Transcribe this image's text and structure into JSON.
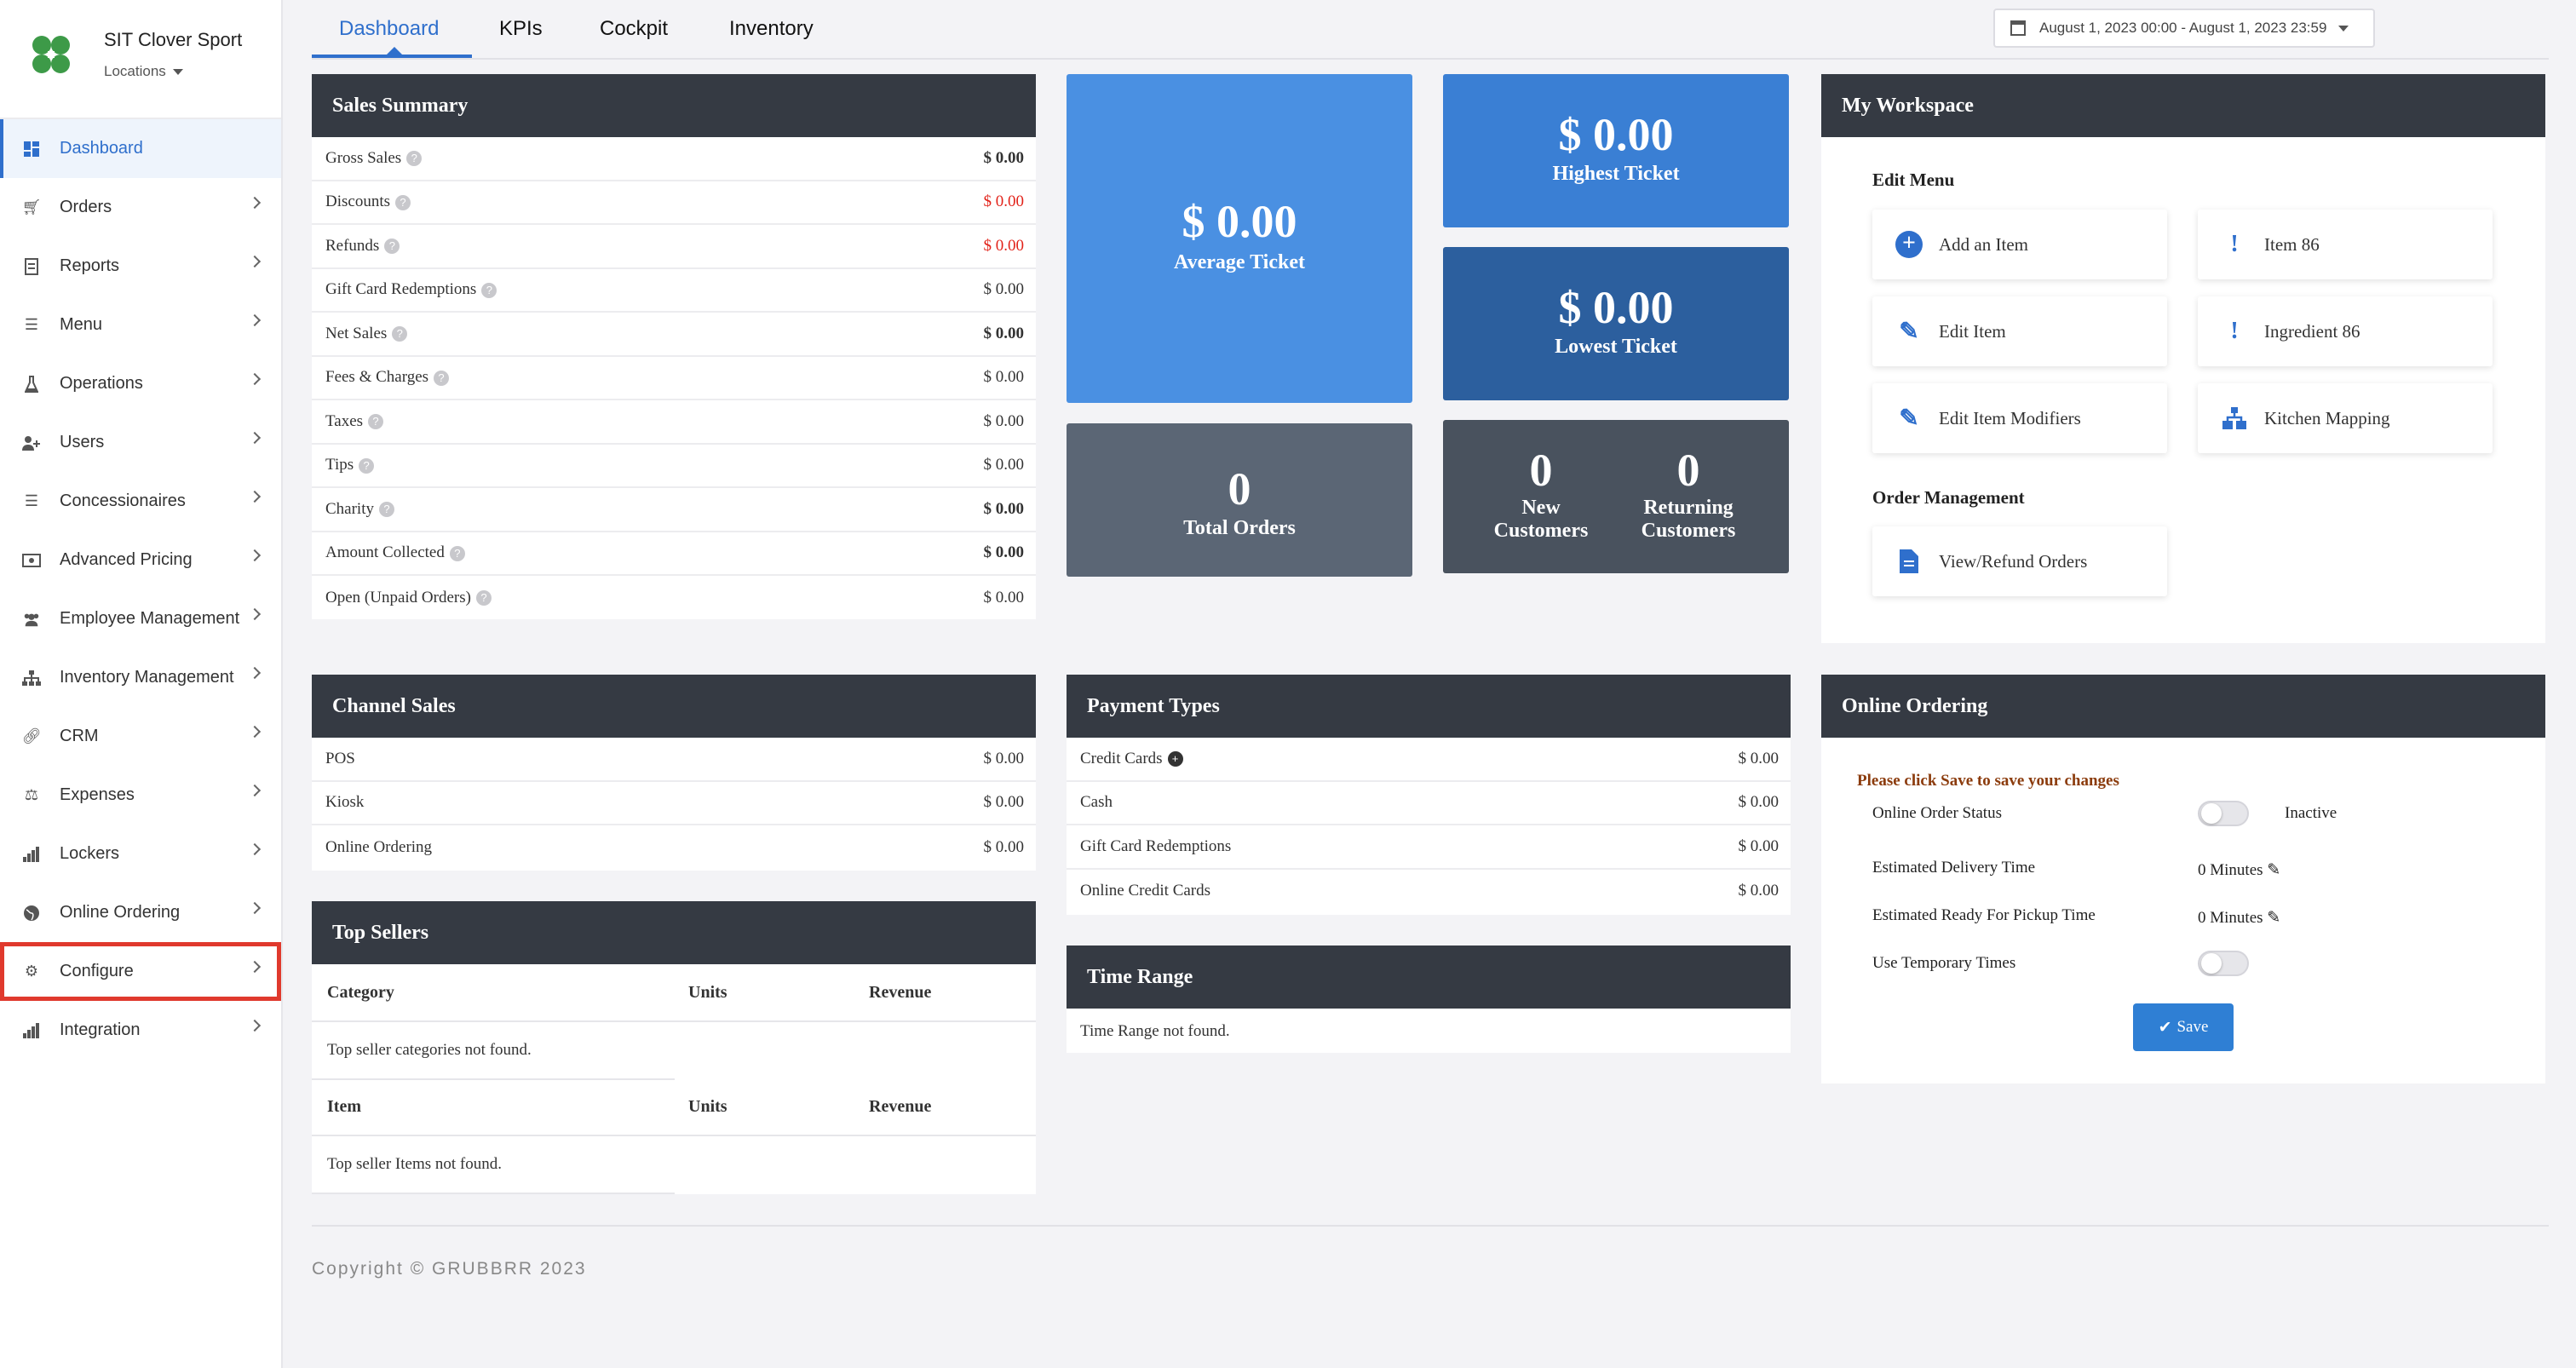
{
  "brand": {
    "name": "SIT Clover Sport",
    "locations_label": "Locations"
  },
  "sidebar": {
    "items": [
      {
        "label": "Dashboard",
        "icon": "dashboard-icon",
        "active": true
      },
      {
        "label": "Orders",
        "icon": "cart-icon"
      },
      {
        "label": "Reports",
        "icon": "report-icon"
      },
      {
        "label": "Menu",
        "icon": "menu-icon"
      },
      {
        "label": "Operations",
        "icon": "flask-icon"
      },
      {
        "label": "Users",
        "icon": "user-plus-icon"
      },
      {
        "label": "Concessionaires",
        "icon": "list-icon"
      },
      {
        "label": "Advanced Pricing",
        "icon": "money-icon"
      },
      {
        "label": "Employee Management",
        "icon": "users-icon"
      },
      {
        "label": "Inventory Management",
        "icon": "sitemap-icon"
      },
      {
        "label": "CRM",
        "icon": "link-icon"
      },
      {
        "label": "Expenses",
        "icon": "scale-icon"
      },
      {
        "label": "Lockers",
        "icon": "signal-icon"
      },
      {
        "label": "Online Ordering",
        "icon": "globe-icon"
      },
      {
        "label": "Configure",
        "icon": "gear-icon",
        "highlighted": true
      },
      {
        "label": "Integration",
        "icon": "signal-icon"
      }
    ]
  },
  "tabs": [
    "Dashboard",
    "KPIs",
    "Cockpit",
    "Inventory"
  ],
  "date_range": "August 1, 2023 00:00 - August 1, 2023 23:59",
  "sales_summary": {
    "title": "Sales Summary",
    "rows": [
      {
        "label": "Gross Sales",
        "value": "$ 0.00",
        "style": "bold"
      },
      {
        "label": "Discounts",
        "value": "$ 0.00",
        "style": "red"
      },
      {
        "label": "Refunds",
        "value": "$ 0.00",
        "style": "red"
      },
      {
        "label": "Gift Card Redemptions",
        "value": "$ 0.00",
        "style": ""
      },
      {
        "label": "Net Sales",
        "value": "$ 0.00",
        "style": "bold"
      },
      {
        "label": "Fees & Charges",
        "value": "$ 0.00",
        "style": ""
      },
      {
        "label": "Taxes",
        "value": "$ 0.00",
        "style": ""
      },
      {
        "label": "Tips",
        "value": "$ 0.00",
        "style": ""
      },
      {
        "label": "Charity",
        "value": "$ 0.00",
        "style": "bold"
      },
      {
        "label": "Amount Collected",
        "value": "$ 0.00",
        "style": "bold"
      },
      {
        "label": "Open (Unpaid Orders)",
        "value": "$ 0.00",
        "style": ""
      }
    ]
  },
  "tiles": {
    "average_ticket": {
      "value": "$ 0.00",
      "label": "Average Ticket",
      "color": "#4a90e2"
    },
    "highest_ticket": {
      "value": "$ 0.00",
      "label": "Highest Ticket",
      "color": "#3a7fd4"
    },
    "lowest_ticket": {
      "value": "$ 0.00",
      "label": "Lowest Ticket",
      "color": "#2c5f9e"
    },
    "total_orders": {
      "value": "0",
      "label": "Total Orders",
      "color": "#5b6675"
    },
    "new_customers": {
      "value": "0",
      "label_line1": "New",
      "label_line2": "Customers"
    },
    "returning_customers": {
      "value": "0",
      "label_line1": "Returning",
      "label_line2": "Customers"
    }
  },
  "workspace": {
    "title": "My Workspace",
    "edit_menu_label": "Edit Menu",
    "order_management_label": "Order Management",
    "buttons": {
      "add_item": "Add an Item",
      "item_86": "Item 86",
      "edit_item": "Edit Item",
      "ingredient_86": "Ingredient 86",
      "edit_item_modifiers": "Edit Item Modifiers",
      "kitchen_mapping": "Kitchen Mapping",
      "view_refund_orders": "View/Refund Orders"
    }
  },
  "channel_sales": {
    "title": "Channel Sales",
    "rows": [
      {
        "label": "POS",
        "value": "$ 0.00"
      },
      {
        "label": "Kiosk",
        "value": "$ 0.00"
      },
      {
        "label": "Online Ordering",
        "value": "$ 0.00"
      }
    ]
  },
  "payment_types": {
    "title": "Payment Types",
    "rows": [
      {
        "label": "Credit Cards",
        "value": "$ 0.00"
      },
      {
        "label": "Cash",
        "value": "$ 0.00"
      },
      {
        "label": "Gift Card Redemptions",
        "value": "$ 0.00"
      },
      {
        "label": "Online Credit Cards",
        "value": "$ 0.00"
      }
    ]
  },
  "top_sellers": {
    "title": "Top Sellers",
    "cat_headers": [
      "Category",
      "Units",
      "Revenue"
    ],
    "cat_empty": "Top seller categories not found.",
    "item_headers": [
      "Item",
      "Units",
      "Revenue"
    ],
    "item_empty": "Top seller Items not found."
  },
  "time_range": {
    "title": "Time Range",
    "empty": "Time Range not found."
  },
  "online_ordering": {
    "title": "Online Ordering",
    "notice": "Please click Save to save your changes",
    "status_label": "Online Order Status",
    "status_value": "Inactive",
    "delivery_label": "Estimated Delivery Time",
    "delivery_value": "0 Minutes",
    "pickup_label": "Estimated Ready For Pickup Time",
    "pickup_value": "0 Minutes",
    "temp_label": "Use Temporary Times",
    "save_label": "Save"
  },
  "footer": {
    "copyright": "Copyright © GRUBBRR 2023"
  }
}
